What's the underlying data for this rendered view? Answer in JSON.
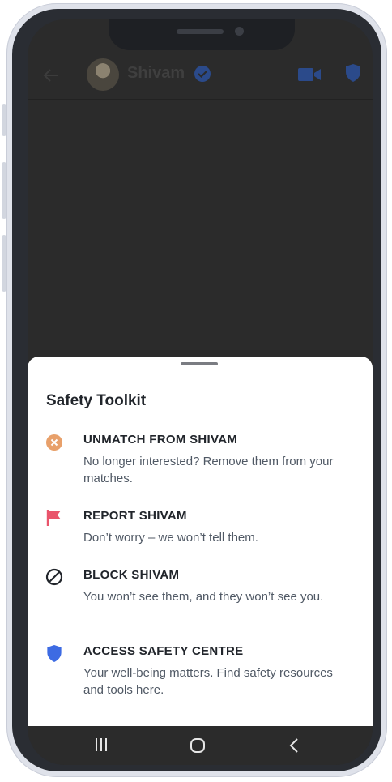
{
  "chat_header": {
    "name": "Shivam",
    "back_icon": "arrow-left-icon",
    "verified_icon": "verified-badge-icon",
    "video_icon": "video-camera-icon",
    "safety_icon": "shield-icon"
  },
  "sheet": {
    "title": "Safety Toolkit",
    "options": [
      {
        "icon": "x-circle-icon",
        "color": "#E8A06A",
        "title": "UNMATCH FROM SHIVAM",
        "desc": "No longer interested? Remove them from your matches."
      },
      {
        "icon": "flag-icon",
        "color": "#E9546B",
        "title": "REPORT SHIVAM",
        "desc": "Don’t worry – we won’t tell them."
      },
      {
        "icon": "block-icon",
        "color": "#21252B",
        "title": "BLOCK SHIVAM",
        "desc": "You won’t see them, and they won’t see you."
      },
      {
        "icon": "shield-icon",
        "color": "#3D6BE3",
        "title": "ACCESS SAFETY CENTRE",
        "desc": "Your well-being matters. Find safety resources and tools here."
      }
    ]
  },
  "nav_bar": {
    "recents_icon": "recents-icon",
    "home_icon": "home-icon",
    "back_icon": "nav-back-icon"
  },
  "colors": {
    "overlay": "#2B2B2B",
    "sheet": "#FFFFFF",
    "accent_blue": "#2B4A8A"
  }
}
